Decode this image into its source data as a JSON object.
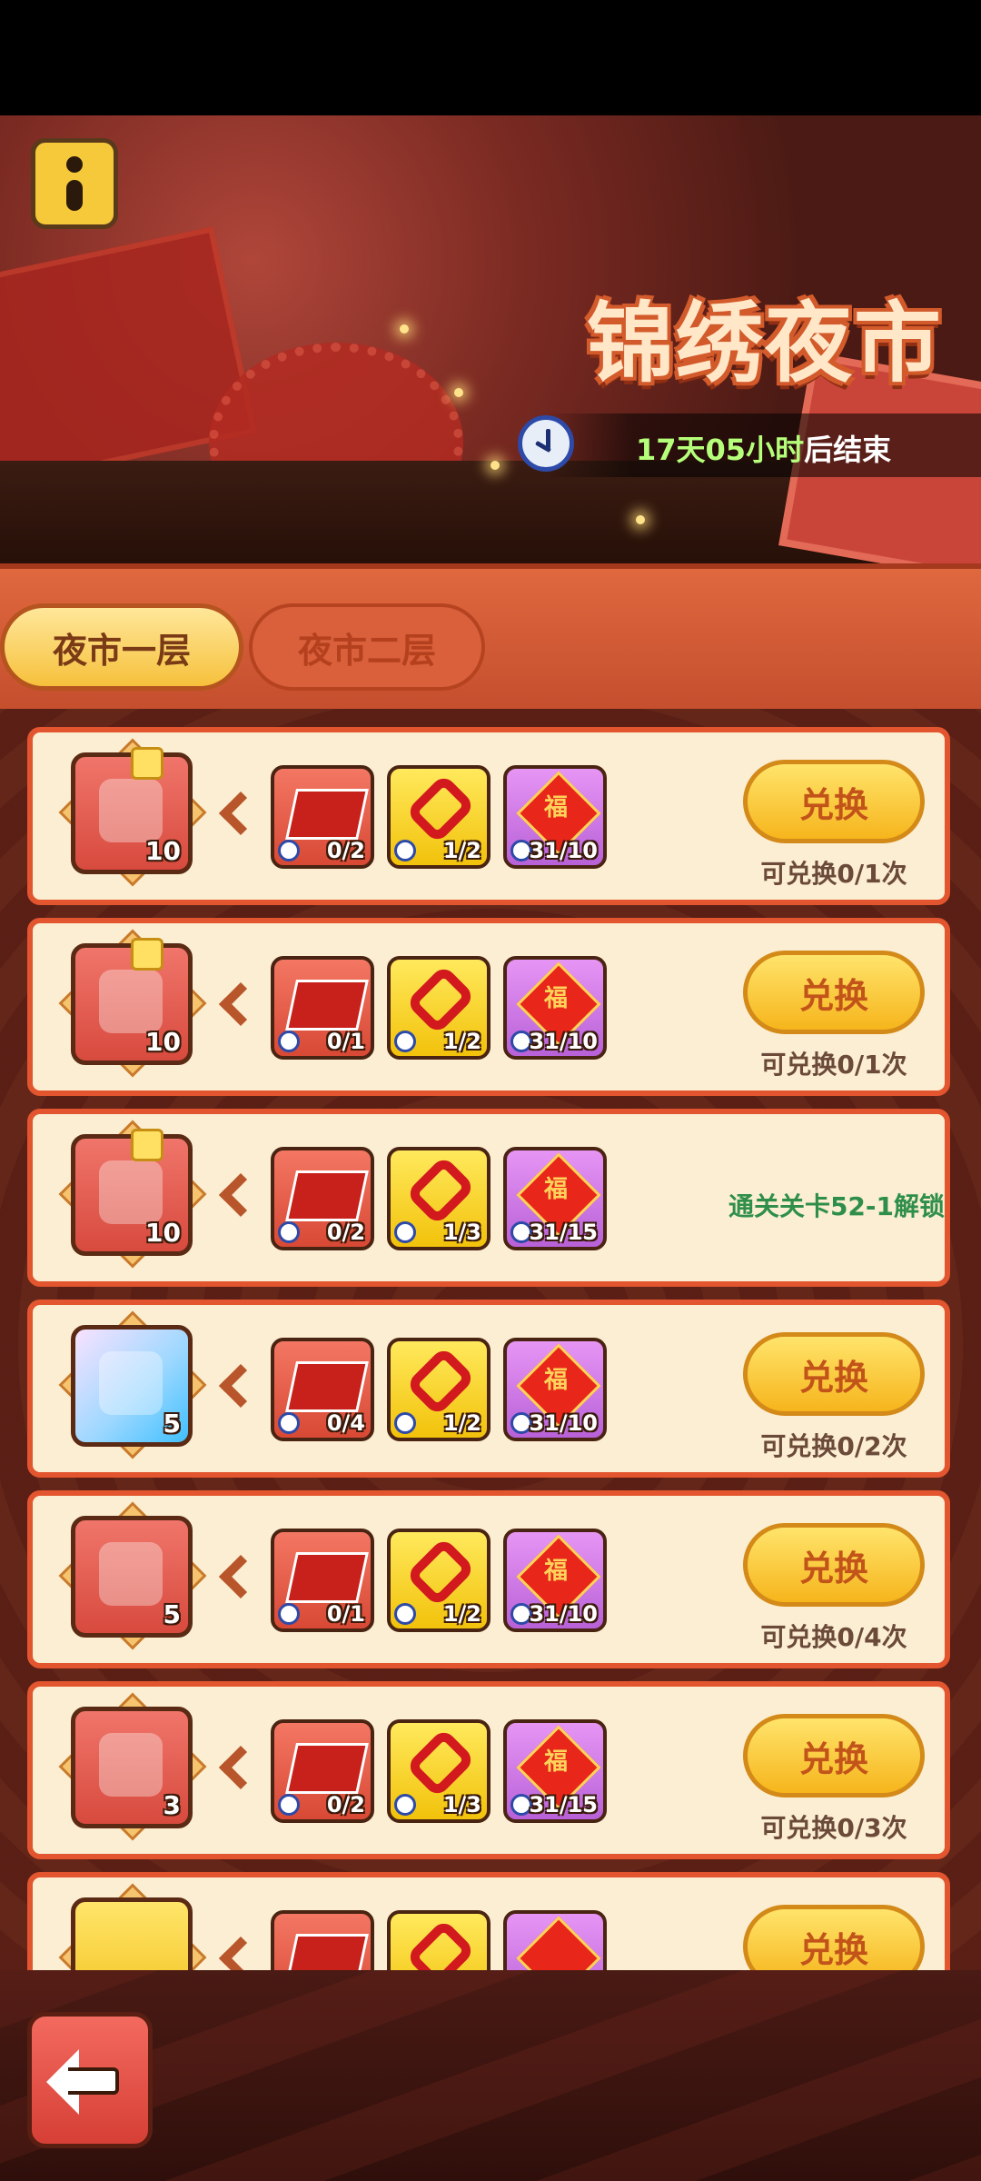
{
  "event": {
    "title": "锦绣夜市",
    "timer_value": "17天05小时",
    "timer_suffix": "后结束"
  },
  "tabs": [
    {
      "label": "夜市一层",
      "active": true
    },
    {
      "label": "夜市二层",
      "active": false
    }
  ],
  "exchange_label": "兑换",
  "rows": [
    {
      "reward_icon": "red-potion-icon",
      "reward_qty": "10",
      "costs": [
        "0/2",
        "1/2",
        "31/10"
      ],
      "limit": "可兑换0/1次",
      "locked": false
    },
    {
      "reward_icon": "green-bean-icon",
      "reward_qty": "10",
      "costs": [
        "0/1",
        "1/2",
        "31/10"
      ],
      "limit": "可兑换0/1次",
      "locked": false
    },
    {
      "reward_icon": "amber-crystal-icon",
      "reward_qty": "10",
      "costs": [
        "0/2",
        "1/3",
        "31/15"
      ],
      "lock_text": "通关关卡52-1解锁",
      "locked": true
    },
    {
      "reward_icon": "rainbow-chest-icon",
      "reward_qty": "5",
      "costs": [
        "0/4",
        "1/2",
        "31/10"
      ],
      "limit": "可兑换0/2次",
      "locked": false
    },
    {
      "reward_icon": "gold-chest-icon",
      "reward_qty": "5",
      "costs": [
        "0/1",
        "1/2",
        "31/10"
      ],
      "limit": "可兑换0/4次",
      "locked": false
    },
    {
      "reward_icon": "purple-scroll-icon",
      "reward_qty": "3",
      "costs": [
        "0/2",
        "1/3",
        "31/15"
      ],
      "limit": "可兑换0/3次",
      "locked": false
    }
  ],
  "fu_char": "福"
}
